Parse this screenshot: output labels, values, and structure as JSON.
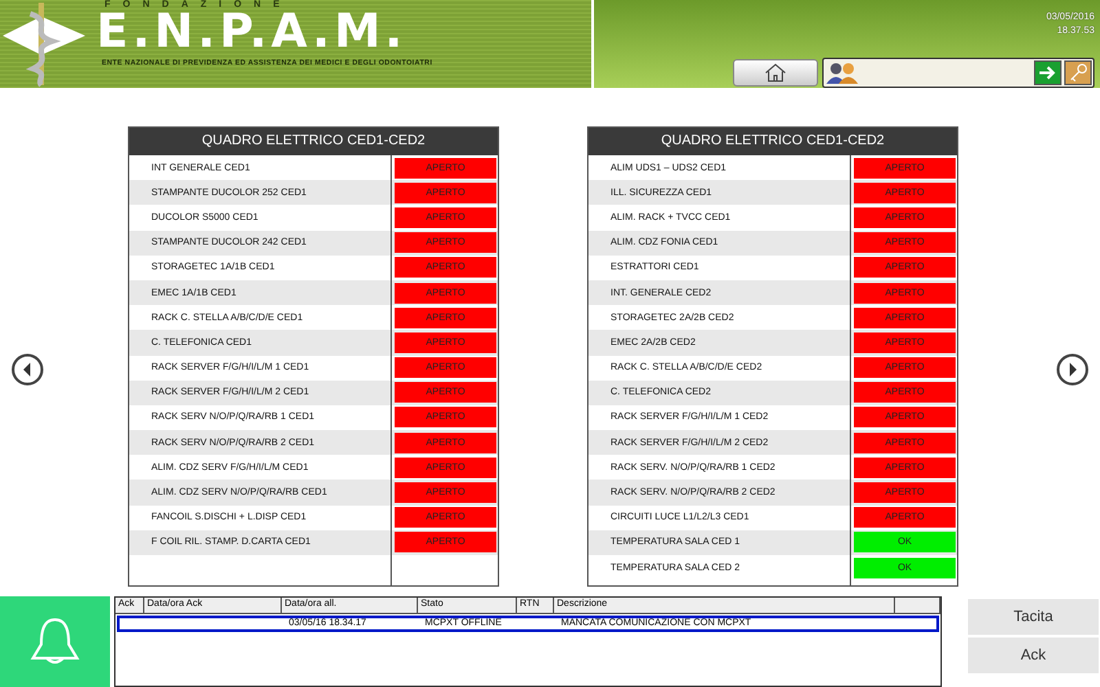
{
  "header": {
    "foundation": "FONDAZIONE",
    "logo": "E.N.P.A.M.",
    "subtitle": "ENTE NAZIONALE DI PREVIDENZA ED ASSISTENZA DEI MEDICI E DEGLI ODONTOIATRI",
    "date": "03/05/2016",
    "time": "18.37.53"
  },
  "panels": [
    {
      "title": "QUADRO ELETTRICO CED1-CED2",
      "rows": [
        {
          "name": "INT GENERALE CED1",
          "status": "APERTO",
          "kind": "alarm"
        },
        {
          "name": "STAMPANTE DUCOLOR 252 CED1",
          "status": "APERTO",
          "kind": "alarm"
        },
        {
          "name": "DUCOLOR S5000 CED1",
          "status": "APERTO",
          "kind": "alarm"
        },
        {
          "name": "STAMPANTE DUCOLOR 242 CED1",
          "status": "APERTO",
          "kind": "alarm"
        },
        {
          "name": "STORAGETEC 1A/1B CED1",
          "status": "APERTO",
          "kind": "alarm"
        },
        {
          "name": "EMEC 1A/1B CED1",
          "status": "APERTO",
          "kind": "alarm"
        },
        {
          "name": "RACK C. STELLA A/B/C/D/E CED1",
          "status": "APERTO",
          "kind": "alarm"
        },
        {
          "name": "C. TELEFONICA CED1",
          "status": "APERTO",
          "kind": "alarm"
        },
        {
          "name": "RACK SERVER F/G/H/I/L/M 1 CED1",
          "status": "APERTO",
          "kind": "alarm"
        },
        {
          "name": "RACK SERVER F/G/H/I/L/M 2 CED1",
          "status": "APERTO",
          "kind": "alarm"
        },
        {
          "name": "RACK SERV N/O/P/Q/RA/RB 1 CED1",
          "status": "APERTO",
          "kind": "alarm"
        },
        {
          "name": "RACK SERV N/O/P/Q/RA/RB 2 CED1",
          "status": "APERTO",
          "kind": "alarm"
        },
        {
          "name": "ALIM. CDZ SERV F/G/H/I/L/M CED1",
          "status": "APERTO",
          "kind": "alarm"
        },
        {
          "name": "ALIM. CDZ SERV N/O/P/Q/RA/RB CED1",
          "status": "APERTO",
          "kind": "alarm"
        },
        {
          "name": "FANCOIL S.DISCHI + L.DISP CED1",
          "status": "APERTO",
          "kind": "alarm"
        },
        {
          "name": "F COIL RIL. STAMP. D.CARTA CED1",
          "status": "APERTO",
          "kind": "alarm"
        }
      ]
    },
    {
      "title": "QUADRO ELETTRICO CED1-CED2",
      "rows": [
        {
          "name": "ALIM UDS1 – UDS2 CED1",
          "status": "APERTO",
          "kind": "alarm"
        },
        {
          "name": "ILL. SICUREZZA CED1",
          "status": "APERTO",
          "kind": "alarm"
        },
        {
          "name": "ALIM. RACK + TVCC CED1",
          "status": "APERTO",
          "kind": "alarm"
        },
        {
          "name": "ALIM. CDZ FONIA CED1",
          "status": "APERTO",
          "kind": "alarm"
        },
        {
          "name": "ESTRATTORI CED1",
          "status": "APERTO",
          "kind": "alarm"
        },
        {
          "name": "INT. GENERALE CED2",
          "status": "APERTO",
          "kind": "alarm"
        },
        {
          "name": "STORAGETEC 2A/2B CED2",
          "status": "APERTO",
          "kind": "alarm"
        },
        {
          "name": "EMEC 2A/2B CED2",
          "status": "APERTO",
          "kind": "alarm"
        },
        {
          "name": "RACK C. STELLA A/B/C/D/E CED2",
          "status": "APERTO",
          "kind": "alarm"
        },
        {
          "name": "C. TELEFONICA CED2",
          "status": "APERTO",
          "kind": "alarm"
        },
        {
          "name": "RACK SERVER F/G/H/I/L/M 1 CED2",
          "status": "APERTO",
          "kind": "alarm"
        },
        {
          "name": "RACK SERVER F/G/H/I/L/M 2 CED2",
          "status": "APERTO",
          "kind": "alarm"
        },
        {
          "name": "RACK SERV. N/O/P/Q/RA/RB 1 CED2",
          "status": "APERTO",
          "kind": "alarm"
        },
        {
          "name": "RACK SERV. N/O/P/Q/RA/RB 2 CED2",
          "status": "APERTO",
          "kind": "alarm"
        },
        {
          "name": "CIRCUITI LUCE L1/L2/L3 CED1",
          "status": "APERTO",
          "kind": "alarm"
        },
        {
          "name": "TEMPERATURA SALA CED 1",
          "status": "OK",
          "kind": "normal"
        },
        {
          "name": "TEMPERATURA SALA CED 2",
          "status": "OK",
          "kind": "normal"
        }
      ]
    }
  ],
  "alarms": {
    "columns": [
      "Ack",
      "Data/ora Ack",
      "Data/ora all.",
      "Stato",
      "RTN",
      "Descrizione"
    ],
    "rows": [
      {
        "date_all": "03/05/16 18.34.17",
        "stato": "MCPXT OFFLINE",
        "descrizione": "MANCATA COMUNICAZIONE CON MCPXT",
        "selected": true
      }
    ]
  },
  "buttons": [
    "Tacita",
    "Ack"
  ]
}
